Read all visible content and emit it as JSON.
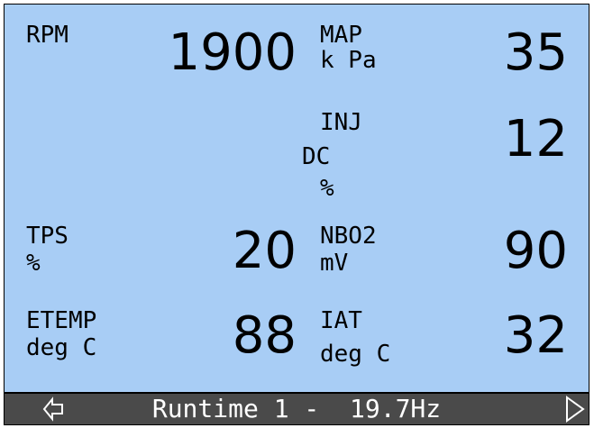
{
  "gauges": {
    "rpm": {
      "label": "RPM",
      "unit": "",
      "value": "1900"
    },
    "map": {
      "label": "MAP",
      "unit": "k Pa",
      "value": "35"
    },
    "inj": {
      "label": "INJ",
      "unit_line1": "DC",
      "unit_line2": "%",
      "value": "12"
    },
    "tps": {
      "label": "TPS",
      "unit": "%",
      "value": "20"
    },
    "nbo2": {
      "label": "NBO2",
      "unit": "mV",
      "value": "90"
    },
    "etemp": {
      "label": "ETEMP",
      "unit": "deg C",
      "value": "88"
    },
    "iat": {
      "label": "IAT",
      "unit": "deg C",
      "value": "32"
    }
  },
  "footer": {
    "title": "Runtime 1 -  19.7Hz",
    "left_icon": "left-arrow-icon",
    "right_icon": "right-arrow-icon"
  },
  "colors": {
    "screen_bg": "#a8cdf5",
    "footer_bg": "#4a4a4a",
    "footer_text": "#ffffff"
  }
}
